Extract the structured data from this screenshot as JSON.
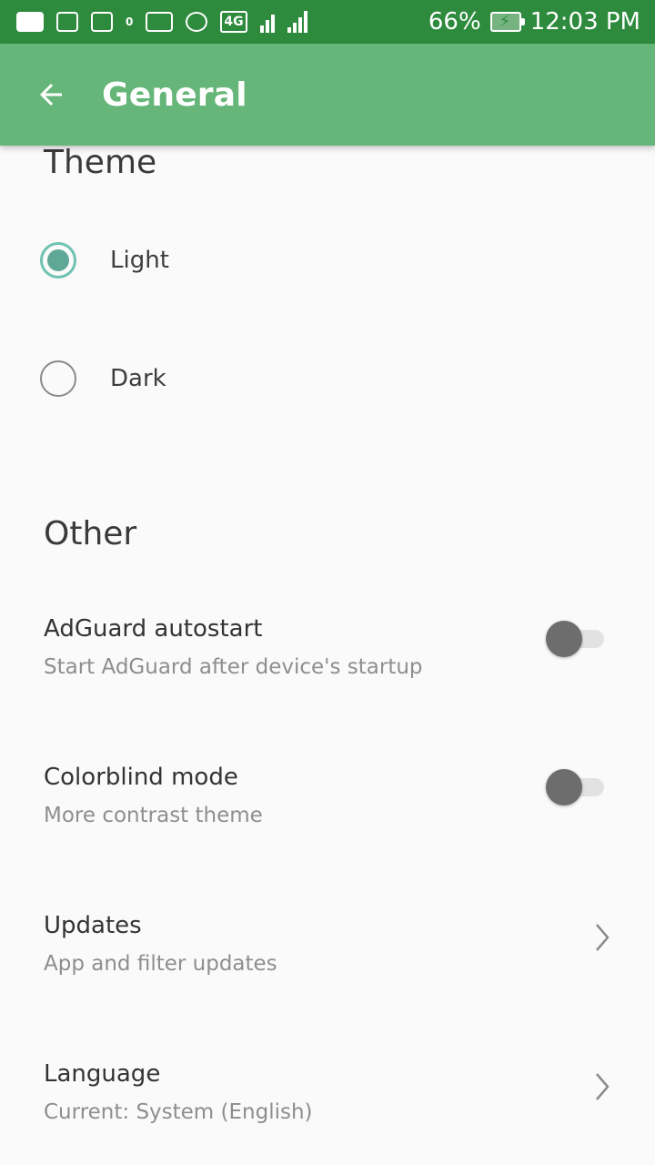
{
  "status_bar": {
    "battery": "66%",
    "time": "12:03 PM",
    "network": "4G",
    "data_counter": "0"
  },
  "app_bar": {
    "title": "General"
  },
  "theme_section": {
    "header": "Theme",
    "options": [
      {
        "label": "Light",
        "selected": true
      },
      {
        "label": "Dark",
        "selected": false
      }
    ]
  },
  "other_section": {
    "header": "Other",
    "items": [
      {
        "title": "AdGuard autostart",
        "subtitle": "Start AdGuard after device's startup",
        "control": "toggle",
        "enabled": false
      },
      {
        "title": "Colorblind mode",
        "subtitle": "More contrast theme",
        "control": "toggle",
        "enabled": false
      },
      {
        "title": "Updates",
        "subtitle": "App and filter updates",
        "control": "chevron-right-icon"
      },
      {
        "title": "Language",
        "subtitle": "Current: System (English)",
        "control": "chevron-right-icon"
      }
    ]
  },
  "colors": {
    "status_bar": "#2e8b3e",
    "app_bar": "#67b679",
    "radio_accent": "#6fc2b2",
    "background": "#fafafa"
  }
}
